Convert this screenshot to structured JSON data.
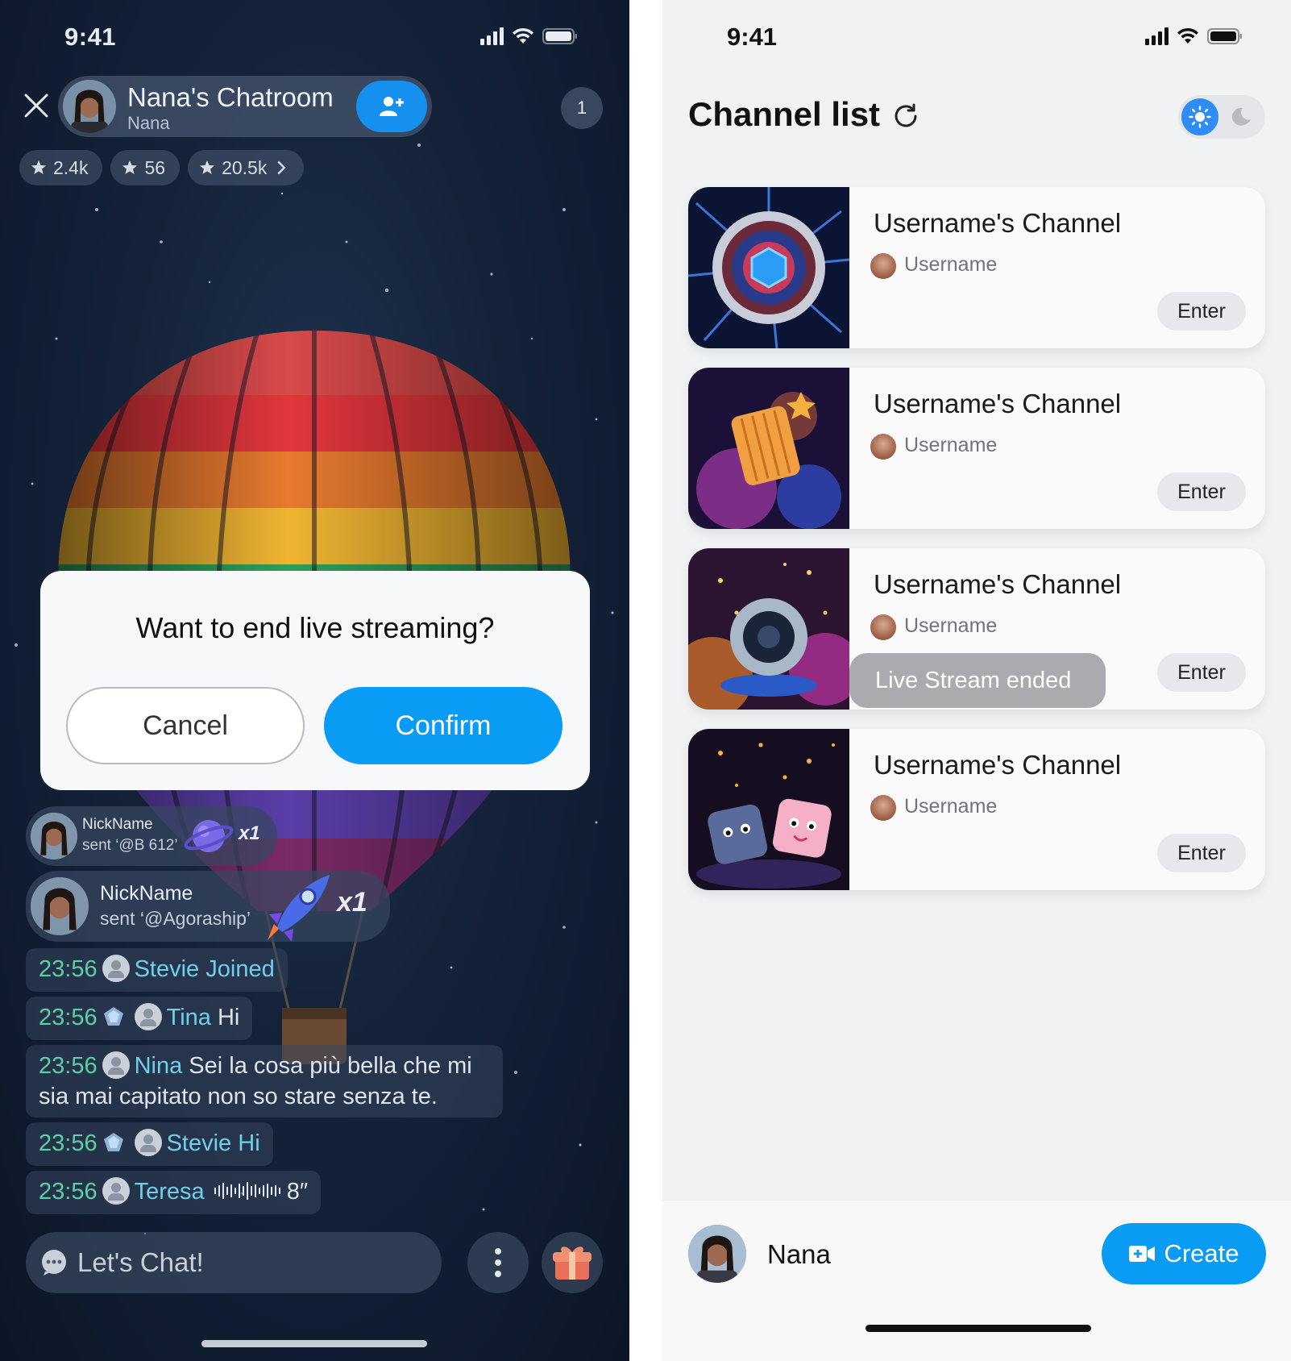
{
  "live_room": {
    "status_time": "9:41",
    "room_title": "Nana's Chatroom",
    "host_name": "Nana",
    "viewer_count": "1",
    "stats": [
      "2.4k",
      "56",
      "20.5k"
    ],
    "dialog": {
      "title": "Want to end live streaming?",
      "cancel_label": "Cancel",
      "confirm_label": "Confirm"
    },
    "gift_messages": [
      {
        "nickname": "NickName",
        "sent": "sent ‘@B 612’",
        "multiplier": "x1"
      },
      {
        "nickname": "NickName",
        "sent": "sent ‘@Agoraship’",
        "multiplier": "x1"
      }
    ],
    "chat": [
      {
        "time": "23:56",
        "name": "Stevie",
        "text": "Joined"
      },
      {
        "time": "23:56",
        "name": "Tina",
        "text": "Hi"
      },
      {
        "time": "23:56",
        "name": "Nina",
        "text": "Sei la cosa più bella che mi sia mai capitato non so stare senza te."
      },
      {
        "time": "23:56",
        "name": "Stevie",
        "text": "Hi"
      },
      {
        "time": "23:56",
        "name": "Teresa",
        "text": "8″"
      }
    ],
    "input_placeholder": "Let's Chat!"
  },
  "channel_list": {
    "status_time": "9:41",
    "title": "Channel list",
    "channels": [
      {
        "title": "Username's Channel",
        "user": "Username",
        "enter_label": "Enter"
      },
      {
        "title": "Username's Channel",
        "user": "Username",
        "enter_label": "Enter"
      },
      {
        "title": "Username's Channel",
        "user": "Username",
        "enter_label": "Enter",
        "status": "Live Stream ended"
      },
      {
        "title": "Username's Channel",
        "user": "Username",
        "enter_label": "Enter"
      }
    ],
    "current_user": "Nana",
    "create_label": "Create",
    "theme": "light"
  },
  "colors": {
    "accent_blue": "#0a9bf4",
    "chat_time_green": "#5bd0a8",
    "chat_name_cyan": "#6fd0e8"
  }
}
